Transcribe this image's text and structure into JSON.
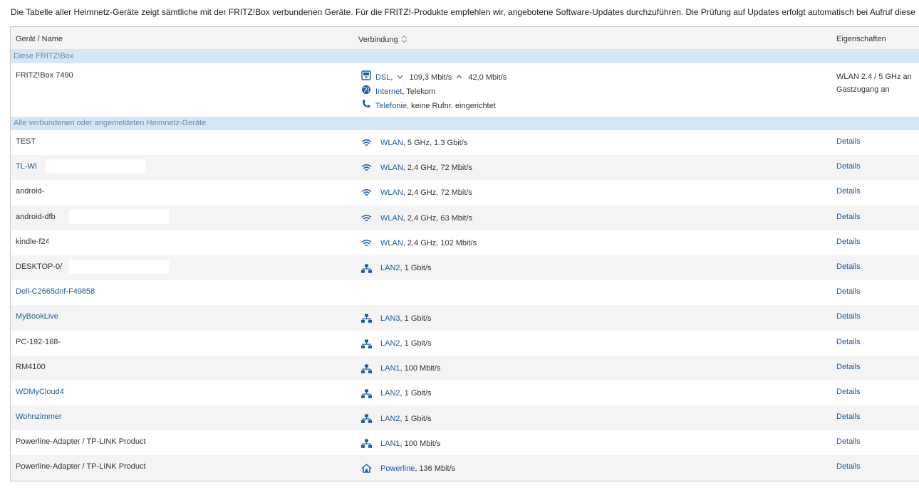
{
  "intro_text": "Die Tabelle aller Heimnetz-Geräte zeigt sämtliche mit der FRITZ!Box verbundenen Geräte. Für die FRITZ!-Produkte empfehlen wir, angebotene Software-Updates durchzuführen. Die Prüfung auf Updates erfolgt automatisch bei Aufruf diese",
  "headers": {
    "name": "Gerät / Name",
    "connection": "Verbindung",
    "properties": "Eigenschaften"
  },
  "sections": {
    "this_box": "Diese FRITZ!Box",
    "connected": "Alle verbundenen oder angemeldeten Heimnetz-Geräte"
  },
  "fritzbox": {
    "name": "FRITZ!Box 7490",
    "dsl_label": "DSL",
    "dsl_sep": ",",
    "dsl_down": "109,3 Mbit/s",
    "dsl_up": "42,0 Mbit/s",
    "internet_label": "Internet",
    "internet_detail": ", Telekom",
    "telefonie_label": "Telefonie",
    "telefonie_detail": ", keine Rufnr. eingerichtet",
    "prop_wlan": "WLAN 2.4 / 5 GHz an",
    "prop_guest": "Gastzugang an"
  },
  "details_label": "Details",
  "devices": [
    {
      "name": "TEST",
      "link": false,
      "icon": "wifi-icon",
      "conn_label": "WLAN",
      "conn_detail": ", 5 GHz, 1.3 Gbit/s"
    },
    {
      "name": "TL-WI",
      "link": true,
      "icon": "wifi-icon",
      "conn_label": "WLAN",
      "conn_detail": ", 2,4 GHz, 72 Mbit/s"
    },
    {
      "name": "android-",
      "link": false,
      "icon": "wifi-icon",
      "conn_label": "WLAN",
      "conn_detail": ", 2,4 GHz, 72 Mbit/s"
    },
    {
      "name": "android-dfb",
      "link": false,
      "icon": "wifi-icon",
      "conn_label": "WLAN",
      "conn_detail": ", 2,4 GHz, 63 Mbit/s"
    },
    {
      "name": "kindle-f24(",
      "link": false,
      "icon": "wifi-icon",
      "conn_label": "WLAN",
      "conn_detail": ", 2,4 GHz, 102 Mbit/s"
    },
    {
      "name": "DESKTOP-0/",
      "link": false,
      "icon": "lan-icon",
      "conn_label": "LAN2",
      "conn_detail": ", 1 Gbit/s"
    },
    {
      "name": "Dell-C2665dnf-F49858",
      "link": true,
      "icon": "",
      "conn_label": "",
      "conn_detail": ""
    },
    {
      "name": "MyBookLive",
      "link": true,
      "icon": "lan-icon",
      "conn_label": "LAN3",
      "conn_detail": ", 1 Gbit/s"
    },
    {
      "name": "PC-192-168-",
      "link": false,
      "icon": "lan-icon",
      "conn_label": "LAN2",
      "conn_detail": ", 1 Gbit/s"
    },
    {
      "name": "RM4100",
      "link": false,
      "icon": "lan-icon",
      "conn_label": "LAN1",
      "conn_detail": ", 100 Mbit/s"
    },
    {
      "name": "WDMyCloud4",
      "link": true,
      "icon": "lan-icon",
      "conn_label": "LAN2",
      "conn_detail": ", 1 Gbit/s"
    },
    {
      "name": "Wohnzimmer",
      "link": true,
      "icon": "lan-icon",
      "conn_label": "LAN2",
      "conn_detail": ", 1 Gbit/s"
    },
    {
      "name": "Powerline-Adapter / TP-LINK Product",
      "link": false,
      "icon": "lan-icon",
      "conn_label": "LAN1",
      "conn_detail": ", 100 Mbit/s"
    },
    {
      "name": "Powerline-Adapter / TP-LINK Product",
      "link": false,
      "icon": "powerline-icon",
      "conn_label": "Powerline",
      "conn_detail": ", 136 Mbit/s"
    }
  ],
  "colors": {
    "link": "#1d5a9a",
    "section_bg": "#d5e6f5",
    "icon": "#1d5a9a"
  }
}
